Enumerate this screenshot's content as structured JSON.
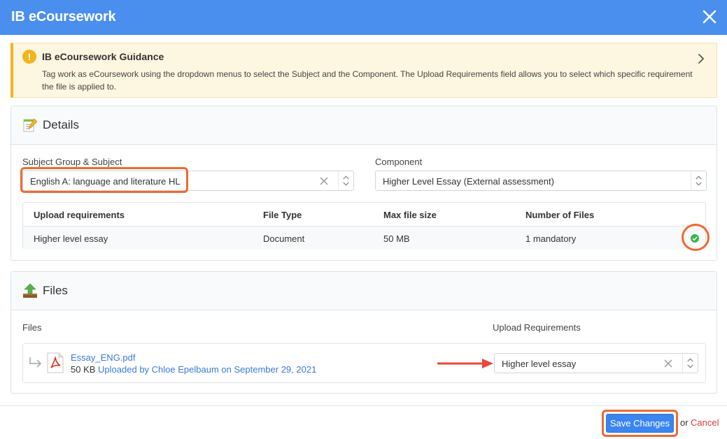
{
  "window": {
    "title": "IB eCoursework"
  },
  "guidance": {
    "title": "IB eCoursework Guidance",
    "text": "Tag work as eCoursework using the dropdown menus to select the Subject and the Component. The Upload Requirements field allows you to select which specific requirement the file is applied to."
  },
  "details": {
    "title": "Details",
    "subject_label": "Subject Group & Subject",
    "subject_value": "English A: language and literature HL",
    "component_label": "Component",
    "component_value": "Higher Level Essay (External assessment)",
    "table": {
      "headers": [
        "Upload requirements",
        "File Type",
        "Max file size",
        "Number of Files"
      ],
      "rows": [
        [
          "Higher level essay",
          "Document",
          "50 MB",
          "1 mandatory"
        ]
      ],
      "status": "complete"
    }
  },
  "files": {
    "title": "Files",
    "files_label": "Files",
    "upload_req_label": "Upload Requirements",
    "file": {
      "name": "Essay_ENG.pdf",
      "size": "50 KB",
      "uploaded_by_prefix": "Uploaded by",
      "uploader": "Chloe Epelbaum",
      "date_text": "on September 29, 2021",
      "requirement": "Higher level essay"
    }
  },
  "footer": {
    "save_label": "Save Changes",
    "or_text": "or",
    "cancel_label": "Cancel"
  },
  "colors": {
    "header": "#4a8fee",
    "highlight": "#ee6a30",
    "warning": "#f2b51c",
    "success": "#3ab54a",
    "link": "#3a7bd5",
    "cancel": "#e23b3b"
  },
  "icons": [
    "close-icon",
    "warning-icon",
    "chevron-right-icon",
    "notepad-icon",
    "upload-icon",
    "clear-icon",
    "updown-arrows-icon",
    "check-circle-icon",
    "subdirectory-arrow-icon",
    "pdf-file-icon"
  ]
}
